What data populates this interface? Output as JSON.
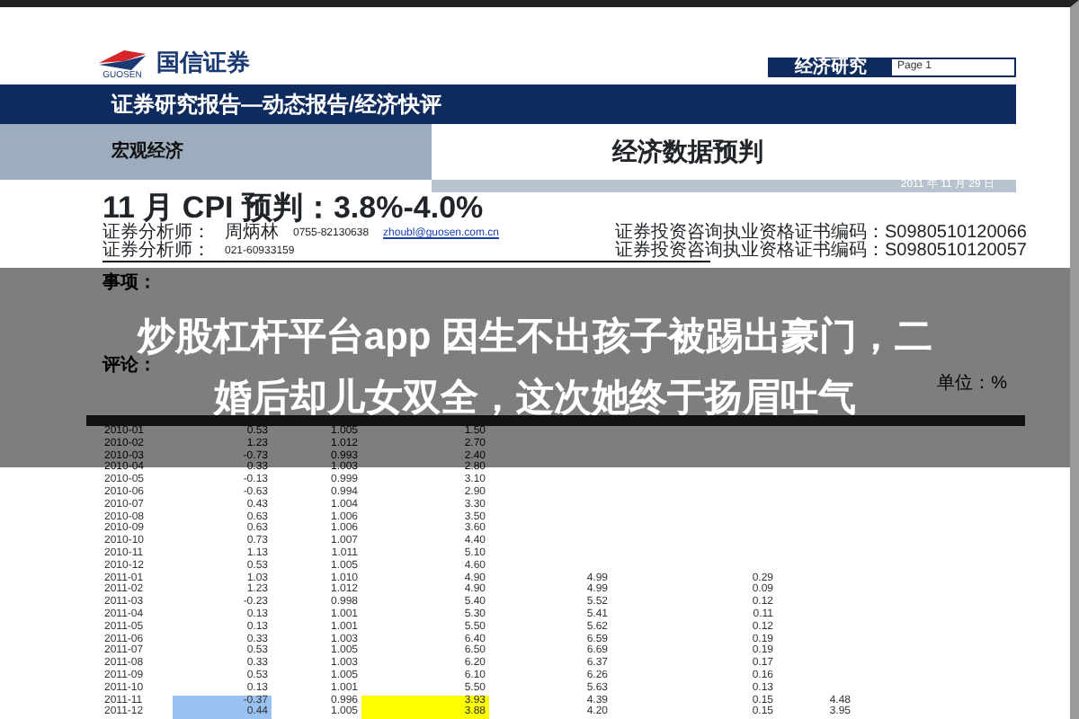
{
  "header": {
    "logo_caption": "GUOSEN",
    "company": "国信证券",
    "section_tag": "经济研究",
    "page_label": "Page 1"
  },
  "banner": "证券研究报告—动态报告/经济快评",
  "category": "宏观经济",
  "report_type": "经济数据预判",
  "date": "2011 年 11 月 29 日",
  "title": "11 月 CPI 预判：3.8%-4.0%",
  "analysts": [
    {
      "label": "证券分析师：",
      "name": "周炳林",
      "phone": "0755-82130638",
      "email": "zhoubl@guosen.com.cn",
      "license": "证券投资咨询执业资格证书编码：S0980510120066"
    },
    {
      "label": "证券分析师：",
      "phone": "021-60933159",
      "license": "证券投资咨询执业资格证书编码：S0980510120057"
    }
  ],
  "sections": [
    "事项：",
    "评论："
  ],
  "unit": "单位：%",
  "table": {
    "rows": [
      {
        "cells": [
          {
            "text": "2010-01"
          },
          {
            "text": "0.53"
          },
          {
            "text": "1.005"
          },
          {
            "text": "1.50"
          }
        ]
      },
      {
        "cells": [
          {
            "text": "2010-02"
          },
          {
            "text": "1.23"
          },
          {
            "text": "1.012"
          },
          {
            "text": "2.70"
          }
        ]
      },
      {
        "cells": [
          {
            "text": "2010-03"
          },
          {
            "text": "-0.73"
          },
          {
            "text": "0.993"
          },
          {
            "text": "2.40"
          }
        ]
      },
      {
        "cells": [
          {
            "text": "2010-04"
          },
          {
            "text": "0.33"
          },
          {
            "text": "1.003"
          },
          {
            "text": "2.80"
          }
        ]
      },
      {
        "cells": [
          {
            "text": "2010-05"
          },
          {
            "text": "-0.13"
          },
          {
            "text": "0.999"
          },
          {
            "text": "3.10"
          }
        ]
      },
      {
        "cells": [
          {
            "text": "2010-06"
          },
          {
            "text": "-0.63"
          },
          {
            "text": "0.994"
          },
          {
            "text": "2.90"
          }
        ]
      },
      {
        "cells": [
          {
            "text": "2010-07"
          },
          {
            "text": "0.43"
          },
          {
            "text": "1.004"
          },
          {
            "text": "3.30"
          }
        ]
      },
      {
        "cells": [
          {
            "text": "2010-08"
          },
          {
            "text": "0.63"
          },
          {
            "text": "1.006"
          },
          {
            "text": "3.50"
          }
        ]
      },
      {
        "cells": [
          {
            "text": "2010-09"
          },
          {
            "text": "0.63"
          },
          {
            "text": "1.006"
          },
          {
            "text": "3.60"
          }
        ]
      },
      {
        "cells": [
          {
            "text": "2010-10"
          },
          {
            "text": "0.73"
          },
          {
            "text": "1.007"
          },
          {
            "text": "4.40"
          }
        ]
      },
      {
        "cells": [
          {
            "text": "2010-11"
          },
          {
            "text": "1.13"
          },
          {
            "text": "1.011"
          },
          {
            "text": "5.10"
          }
        ]
      },
      {
        "cells": [
          {
            "text": "2010-12"
          },
          {
            "text": "0.53"
          },
          {
            "text": "1.005"
          },
          {
            "text": "4.60"
          }
        ]
      },
      {
        "cells": [
          {
            "text": "2011-01"
          },
          {
            "text": "1.03"
          },
          {
            "text": "1.010"
          },
          {
            "text": "4.90"
          },
          {
            "text": "4.99"
          },
          {
            "text": "0.29"
          }
        ]
      },
      {
        "cells": [
          {
            "text": "2011-02"
          },
          {
            "text": "1.23"
          },
          {
            "text": "1.012"
          },
          {
            "text": "4.90"
          },
          {
            "text": "4.99"
          },
          {
            "text": "0.09"
          }
        ]
      },
      {
        "cells": [
          {
            "text": "2011-03"
          },
          {
            "text": "-0.23"
          },
          {
            "text": "0.998"
          },
          {
            "text": "5.40"
          },
          {
            "text": "5.52"
          },
          {
            "text": "0.12"
          }
        ]
      },
      {
        "cells": [
          {
            "text": "2011-04"
          },
          {
            "text": "0.13"
          },
          {
            "text": "1.001"
          },
          {
            "text": "5.30"
          },
          {
            "text": "5.41"
          },
          {
            "text": "0.11"
          }
        ]
      },
      {
        "cells": [
          {
            "text": "2011-05"
          },
          {
            "text": "0.13"
          },
          {
            "text": "1.001"
          },
          {
            "text": "5.50"
          },
          {
            "text": "5.62"
          },
          {
            "text": "0.12"
          }
        ]
      },
      {
        "cells": [
          {
            "text": "2011-06"
          },
          {
            "text": "0.33"
          },
          {
            "text": "1.003"
          },
          {
            "text": "6.40"
          },
          {
            "text": "6.59"
          },
          {
            "text": "0.19"
          }
        ]
      },
      {
        "cells": [
          {
            "text": "2011-07"
          },
          {
            "text": "0.53"
          },
          {
            "text": "1.005"
          },
          {
            "text": "6.50"
          },
          {
            "text": "6.69"
          },
          {
            "text": "0.19"
          }
        ]
      },
      {
        "cells": [
          {
            "text": "2011-08"
          },
          {
            "text": "0.33"
          },
          {
            "text": "1.003"
          },
          {
            "text": "6.20"
          },
          {
            "text": "6.37"
          },
          {
            "text": "0.17"
          }
        ]
      },
      {
        "cells": [
          {
            "text": "2011-09"
          },
          {
            "text": "0.53"
          },
          {
            "text": "1.005"
          },
          {
            "text": "6.10"
          },
          {
            "text": "6.26"
          },
          {
            "text": "0.16"
          }
        ]
      },
      {
        "cells": [
          {
            "text": "2011-10"
          },
          {
            "text": "0.13"
          },
          {
            "text": "1.001"
          },
          {
            "text": "5.50"
          },
          {
            "text": "5.63"
          },
          {
            "text": "0.13"
          }
        ]
      },
      {
        "cells": [
          {
            "text": "2011-11"
          },
          {
            "text": "-0.37",
            "color": "#99c2f0"
          },
          {
            "text": "0.996"
          },
          {
            "text": "3.93",
            "color": "#ffff00"
          },
          {
            "text": "4.39"
          },
          {
            "text": "0.15"
          },
          {
            "text": "4.48"
          }
        ]
      },
      {
        "cells": [
          {
            "text": "2011-12"
          },
          {
            "text": "0.44",
            "color": "#99c2f0"
          },
          {
            "text": "1.005"
          },
          {
            "text": "3.88",
            "color": "#ffff00"
          },
          {
            "text": "4.20"
          },
          {
            "text": "0.15"
          },
          {
            "text": "3.95"
          }
        ]
      }
    ]
  },
  "overlay_headline": [
    "炒股杠杆平台app 因生不出孩子被踢出豪门，二",
    "婚后却儿女双全，这次她终于扬眉吐气"
  ]
}
